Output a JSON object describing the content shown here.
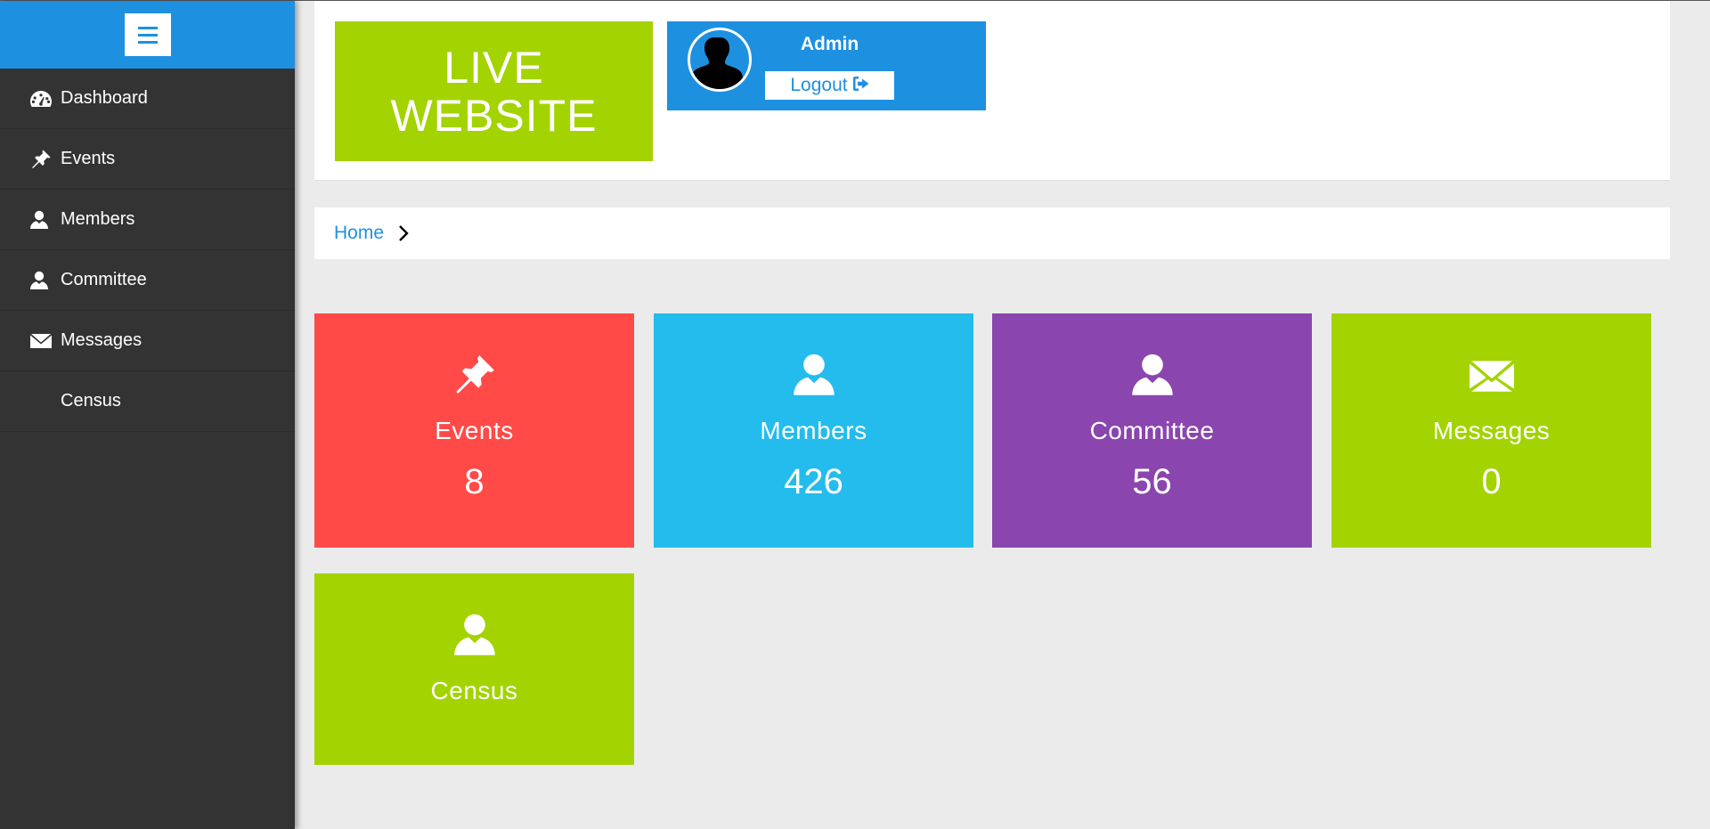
{
  "sidebar": {
    "items": [
      {
        "label": "Dashboard",
        "icon": "dashboard-icon"
      },
      {
        "label": "Events",
        "icon": "pin-icon"
      },
      {
        "label": "Members",
        "icon": "user-icon"
      },
      {
        "label": "Committee",
        "icon": "user-icon"
      },
      {
        "label": "Messages",
        "icon": "envelope-icon"
      },
      {
        "label": "Census",
        "icon": ""
      }
    ]
  },
  "header": {
    "live_website": "LIVE WEBSITE",
    "admin_name": "Admin",
    "logout_label": "Logout"
  },
  "breadcrumb": {
    "home": "Home"
  },
  "tiles": [
    {
      "label": "Events",
      "count": "8",
      "icon": "pin-icon",
      "color": "#ff4a47"
    },
    {
      "label": "Members",
      "count": "426",
      "icon": "user-icon",
      "color": "#24bced"
    },
    {
      "label": "Committee",
      "count": "56",
      "icon": "user-icon",
      "color": "#8a45ae"
    },
    {
      "label": "Messages",
      "count": "0",
      "icon": "envelope-icon",
      "color": "#a3d300"
    },
    {
      "label": "Census",
      "icon": "user-icon",
      "color": "#a3d300"
    }
  ],
  "colors": {
    "accent": "#1e90e0",
    "sidebar_bg": "#333333",
    "lime": "#a3d300"
  }
}
